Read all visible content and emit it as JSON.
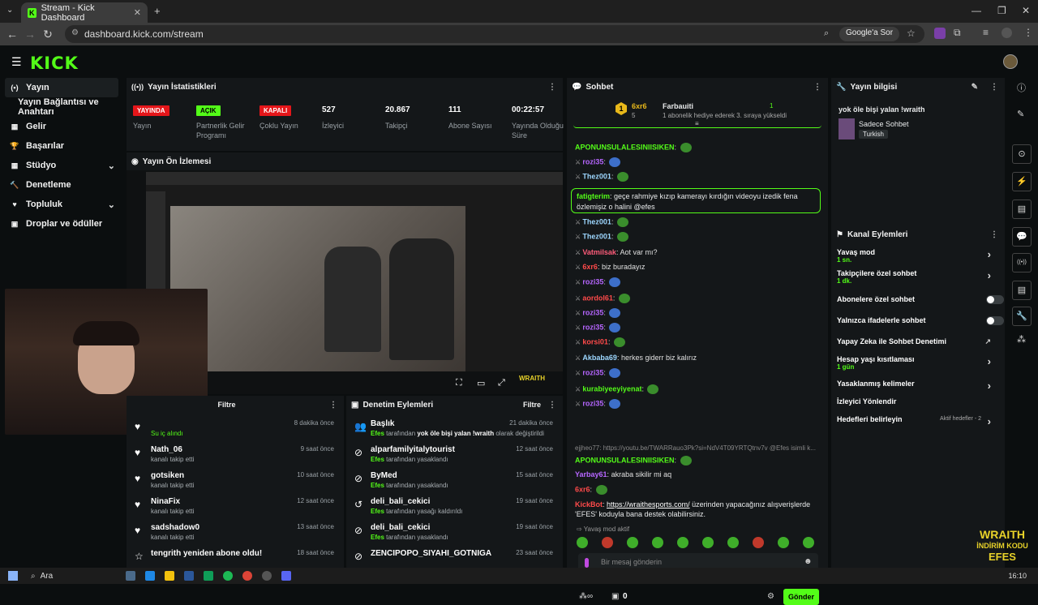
{
  "browser": {
    "tab_title": "Stream - Kick Dashboard",
    "url": "dashboard.kick.com/stream",
    "google_btn": "Google'a Sor"
  },
  "app": {
    "logo": "KICK"
  },
  "sidebar": {
    "items": [
      {
        "label": "Yayın",
        "icon": "(•)"
      },
      {
        "label": "Yayın Bağlantısı ve Anahtarı",
        "icon": ""
      },
      {
        "label": "Gelir",
        "icon": "▦"
      },
      {
        "label": "Başarılar",
        "icon": "🏆"
      },
      {
        "label": "Stüdyo",
        "icon": "▦"
      },
      {
        "label": "Denetleme",
        "icon": "🔨"
      },
      {
        "label": "Topluluk",
        "icon": "♥"
      },
      {
        "label": "Droplar ve ödüller",
        "icon": "▣"
      }
    ]
  },
  "stats": {
    "title": "Yayın İstatistikleri",
    "badges": [
      {
        "badge": "YAYINDA",
        "label": "Yayın",
        "color": "#e5161a",
        "text": "#ffffff"
      },
      {
        "badge": "AÇIK",
        "label": "Partnerlik Gelir Programı",
        "color": "#53fc18",
        "text": "#000000"
      },
      {
        "badge": "KAPALI",
        "label": "Çoklu Yayın",
        "color": "#e5161a",
        "text": "#ffffff"
      }
    ],
    "numbers": [
      {
        "value": "527",
        "label": "İzleyici"
      },
      {
        "value": "20.867",
        "label": "Takipçi"
      },
      {
        "value": "111",
        "label": "Abone Sayısı"
      },
      {
        "value": "00:22:57",
        "label": "Yayında Olduğu Süre"
      }
    ]
  },
  "preview": {
    "title": "Yayın Ön İzlemesi",
    "overlay": "WRAITH"
  },
  "activity": {
    "filter": "Filtre",
    "rows": [
      {
        "name": "",
        "sub": "Su iç alındı",
        "time": "8 dakika önce"
      },
      {
        "name": "Nath_06",
        "sub": "kanalı takip etti",
        "time": "9 saat önce"
      },
      {
        "name": "gotsiken",
        "sub": "kanalı takip etti",
        "time": "10 saat önce"
      },
      {
        "name": "NinaFix",
        "sub": "kanalı takip etti",
        "time": "12 saat önce"
      },
      {
        "name": "sadshadow0",
        "sub": "kanalı takip etti",
        "time": "13 saat önce"
      },
      {
        "name": "tengrith yeniden abone oldu!",
        "sub": "",
        "time": "18 saat önce"
      }
    ]
  },
  "moderation": {
    "title": "Denetim Eylemleri",
    "filter": "Filtre",
    "rows": [
      {
        "name": "Başlık",
        "sub_user": "Efes",
        "sub_mid": " tarafından ",
        "sub_bold": "yok öle bişi yalan !wraith",
        "sub_end": " olarak değiştirildi",
        "time": "21 dakika önce"
      },
      {
        "name": "alparfamilyitalytourist",
        "sub_user": "Efes",
        "sub_mid": " tarafından yasaklandı",
        "sub_bold": "",
        "sub_end": "",
        "time": "12 saat önce"
      },
      {
        "name": "ByMed",
        "sub_user": "Efes",
        "sub_mid": " tarafından yasaklandı",
        "sub_bold": "",
        "sub_end": "",
        "time": "15 saat önce"
      },
      {
        "name": "deli_bali_cekici",
        "sub_user": "Efes",
        "sub_mid": " tarafından yasağı kaldırıldı",
        "sub_bold": "",
        "sub_end": "",
        "time": "19 saat önce"
      },
      {
        "name": "deli_bali_cekici",
        "sub_user": "Efes",
        "sub_mid": " tarafından yasaklandı",
        "sub_bold": "",
        "sub_end": "",
        "time": "19 saat önce"
      },
      {
        "name": "ZENCIPOPO_SIYAHI_GOTNIGA",
        "sub_user": "",
        "sub_mid": "",
        "sub_bold": "",
        "sub_end": "",
        "time": "23 saat önce"
      }
    ]
  },
  "chat": {
    "title": "Sohbet",
    "pinned": {
      "rank": "1",
      "user": "6xr6",
      "gifter": "Farbauiti",
      "count": "5",
      "count2": "1",
      "text": "1 abonelik hediye ederek 3. sıraya yükseldi"
    },
    "messages": [
      {
        "user": "APONUNSULALESINIISIKEN",
        "color": "#53fc18",
        "text": "",
        "emote": true
      },
      {
        "user": "rozi35",
        "color": "#b666ff",
        "text": "",
        "emote": true
      },
      {
        "user": "Thez001",
        "color": "#9dd7ff",
        "text": "",
        "emote": true
      },
      {
        "user": "Thez001",
        "color": "#9dd7ff",
        "text": "",
        "emote": true
      },
      {
        "user": "Thez001",
        "color": "#9dd7ff",
        "text": "",
        "emote": true
      },
      {
        "user": "Vatmilsak",
        "color": "#ff5c7a",
        "text": "Aot var mı?",
        "emote": false
      },
      {
        "user": "6xr6",
        "color": "#ff4a4a",
        "text": "biz buradayız",
        "emote": false
      },
      {
        "user": "rozi35",
        "color": "#b666ff",
        "text": "",
        "emote": true
      },
      {
        "user": "aordol61",
        "color": "#ff4a4a",
        "text": "",
        "emote": true
      },
      {
        "user": "rozi35",
        "color": "#b666ff",
        "text": "",
        "emote": true
      },
      {
        "user": "rozi35",
        "color": "#b666ff",
        "text": "",
        "emote": true
      },
      {
        "user": "korsi01",
        "color": "#ff4a4a",
        "text": "",
        "emote": true
      },
      {
        "user": "Akbaba69",
        "color": "#9dd7ff",
        "text": "herkes giderr biz kalırız",
        "emote": false
      },
      {
        "user": "rozi35",
        "color": "#b666ff",
        "text": "",
        "emote": true
      },
      {
        "user": "kurabiyeeyiyenat",
        "color": "#53fc18",
        "text": "",
        "emote": true
      },
      {
        "user": "rozi35",
        "color": "#b666ff",
        "text": "",
        "emote": true
      }
    ],
    "highlight": {
      "user": "fatigterim",
      "text": "geçe rahmiye kızıp kamerayı kırdığın videoyu izedik fena özlemişiz o halini @efes"
    },
    "reply_line": "ejjheo77: https://youtu.be/TWARRauo3Pk?si=NdV4T09YRTQtnv7v @Efes isimli k...",
    "late": [
      {
        "user": "APONUNSULALESINIISIKEN",
        "color": "#53fc18",
        "text": ""
      },
      {
        "user": "Yarbay61",
        "color": "#b666ff",
        "text": "akraba sikilir mi aq"
      },
      {
        "user": "6xr6",
        "color": "#ff4a4a",
        "text": ""
      }
    ],
    "bot": {
      "user": "KickBot",
      "link": "https://wraithesports.com/",
      "text": " üzerinden yapacağınız alışverişlerde 'EFES' koduyla bana destek olabilirsiniz."
    },
    "slow": "Yavaş mod aktif",
    "placeholder": "Bir mesaj gönderin",
    "send": "Gönder",
    "points": "0"
  },
  "info": {
    "title": "Yayın bilgisi",
    "stream_title": "yok öle bişi yalan !wraith",
    "category": "Sadece Sohbet",
    "language": "Turkish"
  },
  "channel": {
    "title": "Kanal Eylemleri",
    "rows": [
      {
        "label": "Yavaş mod",
        "sub": "1 sn.",
        "control": "chev"
      },
      {
        "label": "Takipçilere özel sohbet",
        "sub": "1 dk.",
        "control": "chev"
      },
      {
        "label": "Abonelere özel sohbet",
        "sub": "",
        "control": "toggle"
      },
      {
        "label": "Yalnızca ifadelerle sohbet",
        "sub": "",
        "control": "toggle"
      },
      {
        "label": "Yapay Zeka ile Sohbet Denetimi",
        "sub": "",
        "control": "ext"
      },
      {
        "label": "Hesap yaşı kısıtlaması",
        "sub": "1 gün",
        "control": "chev"
      },
      {
        "label": "Yasaklanmış kelimeler",
        "sub": "",
        "control": "chev"
      },
      {
        "label": "İzleyici Yönlendir",
        "sub": "",
        "control": ""
      },
      {
        "label": "Hedefleri belirleyin",
        "sub": "",
        "control": "chev",
        "extra": "Aktif hedefler - 2"
      }
    ]
  },
  "taskbar": {
    "search": "Ara",
    "time": "16:10",
    "overlay_top": "WRAITH",
    "overlay_mid": "İNDİRİM KODU",
    "overlay_bottom": "EFES"
  },
  "colors": {
    "accent": "#53fc18",
    "live": "#e5161a",
    "panel": "#141719"
  }
}
